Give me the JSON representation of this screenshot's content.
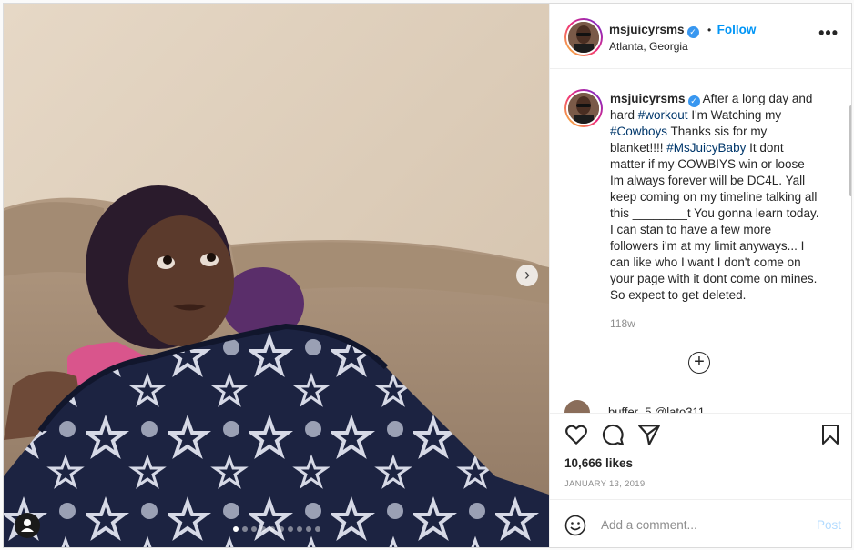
{
  "post": {
    "username": "msjuicyrsms",
    "verified_mark": "✓",
    "follow_sep": "•",
    "follow_label": "Follow",
    "location": "Atlanta, Georgia",
    "more_label": "•••",
    "photo_alt": "Photo by msjuicyrsms",
    "carousel": {
      "total": 10,
      "active": 0
    },
    "next_label": "›"
  },
  "caption": {
    "username": "msjuicyrsms",
    "parts": [
      {
        "text": " After a long day and hard "
      },
      {
        "text": "#workout",
        "tag": true
      },
      {
        "text": " I'm Watching my "
      },
      {
        "text": "#Cowboys",
        "tag": true
      },
      {
        "text": " Thanks sis for my blanket!!!! "
      },
      {
        "text": "#MsJuicyBaby",
        "tag": true
      },
      {
        "text": " It dont matter if my COWBIYS win or loose Im always forever will be DC4L. Yall keep coming on my timeline talking all this ________t You gonna learn today. I can stan to have a few more followers i'm at my limit anyways... I can like who I want I don't come on your page with it dont come on mines. So expect to get deleted."
      }
    ],
    "time": "118w",
    "load_more_label": "+"
  },
  "next_comment_peek": "buffer_5 @lato311",
  "actions": {
    "like_icon": "heart-icon",
    "comment_icon": "comment-icon",
    "share_icon": "share-icon",
    "save_icon": "bookmark-icon",
    "likes": "10,666 likes",
    "date": "JANUARY 13, 2019"
  },
  "add_comment": {
    "emoji_icon": "emoji-icon",
    "placeholder": "Add a comment...",
    "post_label": "Post"
  },
  "colors": {
    "link": "#0095f6",
    "hashtag": "#00376b",
    "muted": "#8e8e8e",
    "post_disabled": "#b3dbff"
  }
}
